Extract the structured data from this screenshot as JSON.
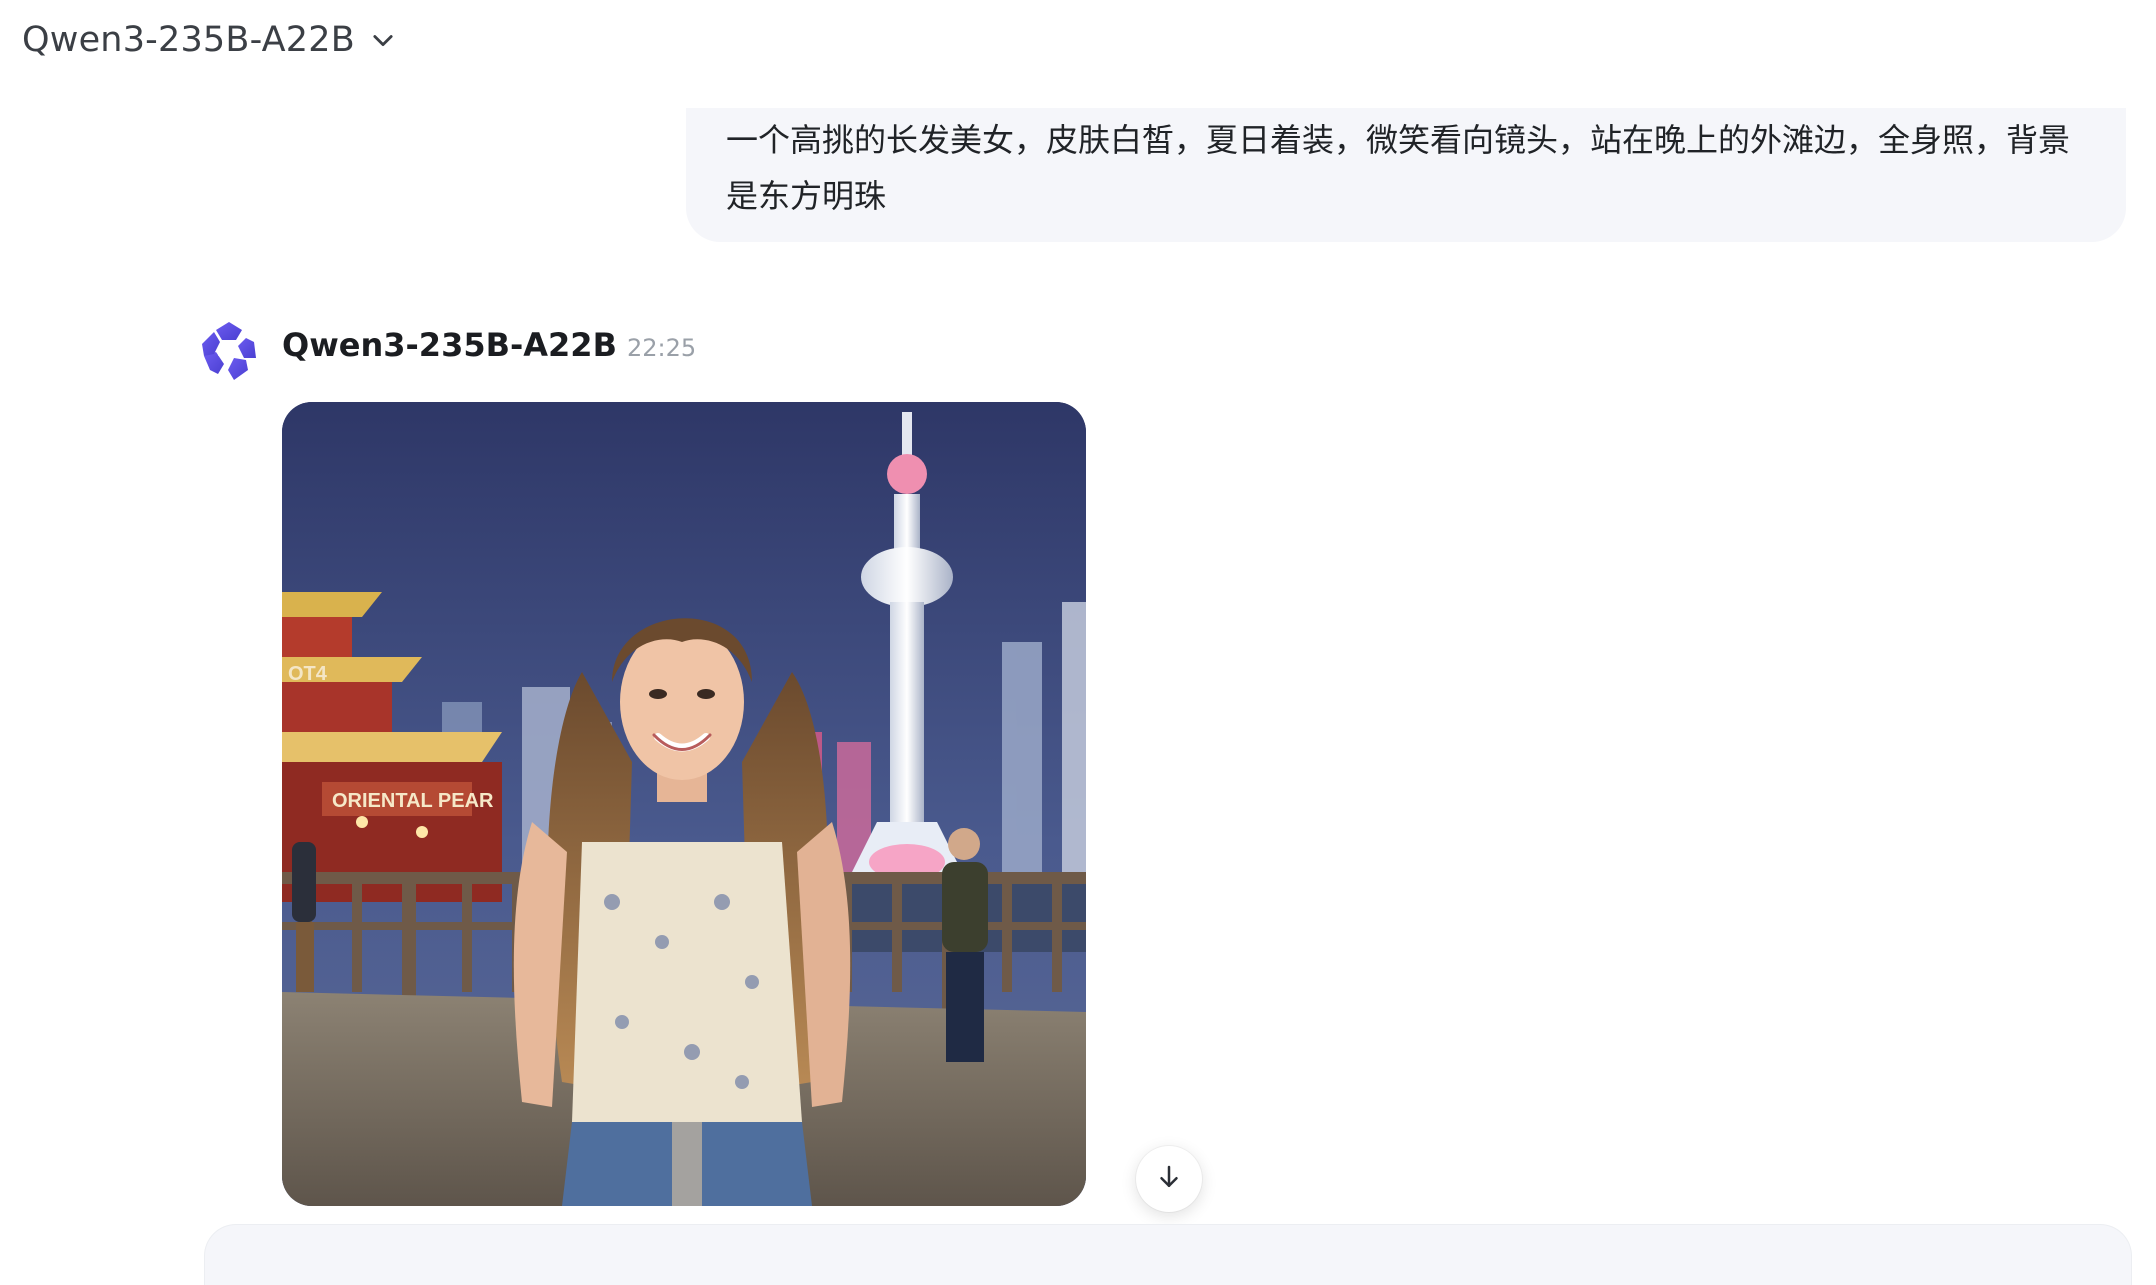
{
  "header": {
    "model_name": "Qwen3-235B-A22B",
    "dropdown_icon": "chevron-down-icon"
  },
  "conversation": {
    "user_message": {
      "text": "一个高挑的长发美女，皮肤白皙，夏日着装，微笑看向镜头，站在晚上的外滩边，全身照，背景是东方明珠"
    },
    "assistant_message": {
      "avatar_icon": "qwen-logo-icon",
      "name": "Qwen3-235B-A22B",
      "time": "22:25",
      "image": {
        "sign_texts": [
          "OT4",
          "ORIENTAL PEAR"
        ]
      }
    }
  },
  "controls": {
    "scroll_bottom_icon": "arrow-down-icon"
  },
  "colors": {
    "accent": "#5b4fe0",
    "bubble_bg": "#f5f6fa",
    "muted_text": "#9aa0a8"
  }
}
